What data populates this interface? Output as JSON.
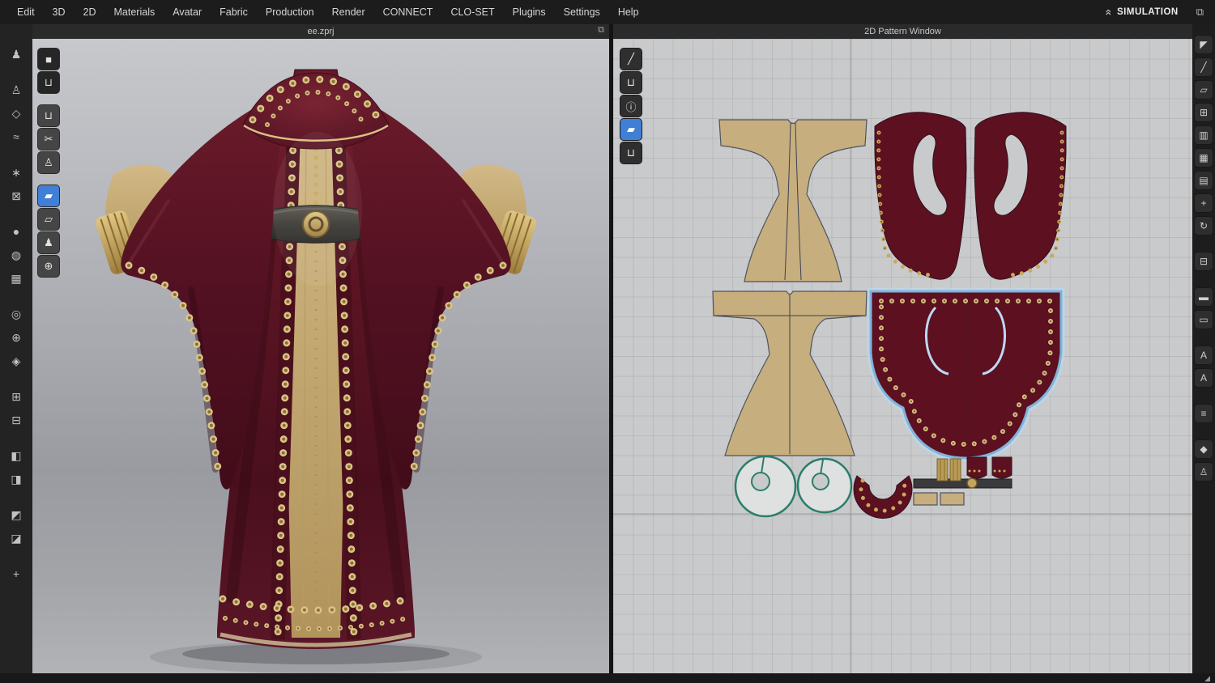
{
  "menubar": {
    "items": [
      {
        "name": "menu-edit",
        "label": "Edit"
      },
      {
        "name": "menu-3d",
        "label": "3D"
      },
      {
        "name": "menu-2d",
        "label": "2D"
      },
      {
        "name": "menu-materials",
        "label": "Materials"
      },
      {
        "name": "menu-avatar",
        "label": "Avatar"
      },
      {
        "name": "menu-fabric",
        "label": "Fabric"
      },
      {
        "name": "menu-production",
        "label": "Production"
      },
      {
        "name": "menu-render",
        "label": "Render"
      },
      {
        "name": "menu-connect",
        "label": "CONNECT"
      },
      {
        "name": "menu-clo-set",
        "label": "CLO-SET"
      },
      {
        "name": "menu-plugins",
        "label": "Plugins"
      },
      {
        "name": "menu-settings",
        "label": "Settings"
      },
      {
        "name": "menu-help",
        "label": "Help"
      }
    ],
    "simulation": {
      "label": "SIMULATION"
    }
  },
  "windows": {
    "garment": {
      "title": "ee.zprj"
    },
    "pattern": {
      "title": "2D Pattern Window"
    }
  },
  "icons": {
    "float_window": "⧉",
    "collapse_chevrons": "»",
    "library_panel": "⧉",
    "resize_corner": "◢"
  },
  "toolbars": {
    "left": [
      {
        "name": "avatar-show-icon",
        "glyph": "♟"
      },
      {
        "type": "spacer"
      },
      {
        "name": "avatar-pose-icon",
        "glyph": "♙"
      },
      {
        "name": "avatar-size-icon",
        "glyph": "◇"
      },
      {
        "name": "avatar-tape-icon",
        "glyph": "≈"
      },
      {
        "type": "spacer"
      },
      {
        "name": "avatar-arrange-point-icon",
        "glyph": "∗"
      },
      {
        "name": "avatar-bounding-icon",
        "glyph": "⊠"
      },
      {
        "type": "spacer"
      },
      {
        "name": "render-sphere-icon",
        "glyph": "●"
      },
      {
        "name": "hair-material-icon",
        "glyph": "◍"
      },
      {
        "name": "checkerboard-texture-icon",
        "glyph": "▦"
      },
      {
        "type": "spacer"
      },
      {
        "name": "aim-sphere-icon",
        "glyph": "◎"
      },
      {
        "name": "globe-grid-icon",
        "glyph": "⊕"
      },
      {
        "name": "lock-diamond-icon",
        "glyph": "◈"
      },
      {
        "type": "spacer"
      },
      {
        "name": "layer-front-icon",
        "glyph": "⊞"
      },
      {
        "name": "layer-back-icon",
        "glyph": "⊟"
      },
      {
        "type": "spacer"
      },
      {
        "name": "viewport-layout-1-icon",
        "glyph": "◧"
      },
      {
        "name": "viewport-layout-2-icon",
        "glyph": "◨"
      },
      {
        "type": "spacer"
      },
      {
        "name": "viewport-layout-3-icon",
        "glyph": "◩"
      },
      {
        "name": "viewport-layout-4-icon",
        "glyph": "◪"
      },
      {
        "type": "spacer"
      },
      {
        "name": "pin-icon",
        "glyph": "+"
      }
    ],
    "scene": [
      {
        "name": "view-cube-icon",
        "glyph": "■",
        "style": "dark"
      },
      {
        "name": "garment-toggle-icon",
        "glyph": "⊔",
        "style": "dark"
      },
      {
        "type": "spacer"
      },
      {
        "name": "show-garment-icon",
        "glyph": "⊔"
      },
      {
        "name": "seam-tool-icon",
        "glyph": "✂"
      },
      {
        "name": "avatar-toggle-icon",
        "glyph": "♙"
      },
      {
        "type": "spacer"
      },
      {
        "name": "fabric-view-active-icon",
        "glyph": "▰",
        "style": "active"
      },
      {
        "name": "fabric-view-icon",
        "glyph": "▱"
      },
      {
        "name": "mannequin-icon",
        "glyph": "♟"
      },
      {
        "name": "world-icon",
        "glyph": "⊕"
      }
    ],
    "pattern": [
      {
        "name": "stitch-pen-icon",
        "glyph": "╱",
        "style": "dark"
      },
      {
        "name": "pattern-garment-icon",
        "glyph": "⊔"
      },
      {
        "name": "pattern-info-icon",
        "glyph": "ⓘ"
      },
      {
        "name": "pattern-fabric-active-icon",
        "glyph": "▰",
        "style": "active"
      },
      {
        "name": "pattern-shirt-icon",
        "glyph": "⊔"
      }
    ],
    "right": [
      {
        "name": "select-tool-icon",
        "glyph": "◤"
      },
      {
        "name": "edit-pattern-icon",
        "glyph": "╱"
      },
      {
        "name": "create-pattern-icon",
        "glyph": "▱"
      },
      {
        "name": "clone-pattern-icon",
        "glyph": "⊞"
      },
      {
        "name": "trace-tool-icon",
        "glyph": "▥"
      },
      {
        "name": "grid-tool-icon",
        "glyph": "▦"
      },
      {
        "name": "notch-tool-icon",
        "glyph": "▤"
      },
      {
        "name": "dart-tool-icon",
        "glyph": "+"
      },
      {
        "name": "unfold-tool-icon",
        "glyph": "↻"
      },
      {
        "type": "spacer"
      },
      {
        "name": "layer-clone-icon",
        "glyph": "⊟"
      },
      {
        "type": "spacer"
      },
      {
        "name": "ruler-icon",
        "glyph": "▬"
      },
      {
        "name": "tape-measure-icon",
        "glyph": "▭"
      },
      {
        "type": "spacer"
      },
      {
        "name": "text-tool-icon",
        "glyph": "A"
      },
      {
        "name": "font-style-icon",
        "glyph": "A"
      },
      {
        "type": "spacer"
      },
      {
        "name": "grading-list-icon",
        "glyph": "≡"
      },
      {
        "type": "spacer"
      },
      {
        "name": "fabric-transform-icon",
        "glyph": "◆"
      },
      {
        "name": "avatar-pattern-icon",
        "glyph": "♙"
      }
    ]
  },
  "colors": {
    "accent_blue": "#3f7fd6",
    "selection_blue": "#7fb3dc",
    "selection_glow": "#bcd9ef",
    "garment_maroon": "#5a1522",
    "garment_maroon_dark": "#400d18",
    "pattern_maroon": "#5c1020",
    "tan": "#c7ae7e",
    "gold": "#c2a55c",
    "belt_gray": "#3a393c",
    "grid_bg": "#c9cacb",
    "teal_outline": "#2b7d6b"
  },
  "pattern_pieces": {
    "front_bodice": "front bodice panel",
    "sleeve_panel": "sleeve cross panel",
    "back_pair": "back/sleeve pair",
    "selected_robe_body": "robe body (selected)",
    "collar_ring_large": "collar ring large",
    "collar_ring_small": "collar ring small",
    "collar_crescent": "collar crescent",
    "belt_strip": "belt strip"
  }
}
